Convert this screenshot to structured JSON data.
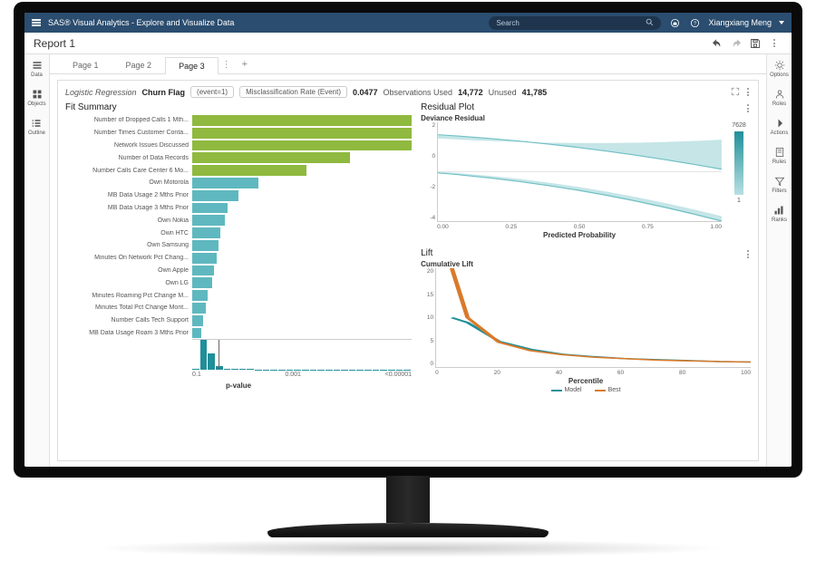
{
  "topbar": {
    "title": "SAS® Visual Analytics - Explore and Visualize Data",
    "search_placeholder": "Search",
    "user": "Xiangxiang Meng"
  },
  "report": {
    "title": "Report 1",
    "tabs": [
      "Page 1",
      "Page 2",
      "Page 3"
    ],
    "active_tab": 2
  },
  "left_rail": [
    {
      "id": "data",
      "label": "Data"
    },
    {
      "id": "objects",
      "label": "Objects"
    },
    {
      "id": "outline",
      "label": "Outline"
    }
  ],
  "right_rail": [
    {
      "id": "options",
      "label": "Options"
    },
    {
      "id": "roles",
      "label": "Roles"
    },
    {
      "id": "actions",
      "label": "Actions"
    },
    {
      "id": "rules",
      "label": "Rules"
    },
    {
      "id": "filters",
      "label": "Filters"
    },
    {
      "id": "ranks",
      "label": "Ranks"
    }
  ],
  "model_hdr": {
    "model_type": "Logistic Regression",
    "target": "Churn Flag",
    "event_label": "(event=1)",
    "metric_btn": "Misclassification Rate (Event)",
    "metric_val": "0.0477",
    "obs_used_label": "Observations Used",
    "obs_used": "14,772",
    "unused_label": "Unused",
    "unused": "41,785"
  },
  "chart_data": [
    {
      "type": "bar",
      "title": "Fit Summary",
      "xlabel": "p-value",
      "x_ticks": [
        "0.1",
        "0.001",
        "<0.00001"
      ],
      "orientation": "horizontal",
      "note": "bar length ∝ −log10(p); colors: green = p<0.05, teal = otherwise",
      "items": [
        {
          "label": "Number of Dropped Calls 1 Mth...",
          "len": 1.0,
          "sig": true
        },
        {
          "label": "Number Times Customer Conta...",
          "len": 1.0,
          "sig": true
        },
        {
          "label": "Network Issues Discussed",
          "len": 1.0,
          "sig": true
        },
        {
          "label": "Number of Data Records",
          "len": 0.72,
          "sig": true
        },
        {
          "label": "Number Calls Care Center 6 Mo...",
          "len": 0.52,
          "sig": true
        },
        {
          "label": "Own Motorola",
          "len": 0.3,
          "sig": false
        },
        {
          "label": "MB Data Usage 2 Mths Prior",
          "len": 0.21,
          "sig": false
        },
        {
          "label": "MB Data Usage 3 Mths Prior",
          "len": 0.16,
          "sig": false
        },
        {
          "label": "Own Nokia",
          "len": 0.15,
          "sig": false
        },
        {
          "label": "Own HTC",
          "len": 0.13,
          "sig": false
        },
        {
          "label": "Own Samsung",
          "len": 0.12,
          "sig": false
        },
        {
          "label": "Minutes On Network Pct Chang...",
          "len": 0.11,
          "sig": false
        },
        {
          "label": "Own Apple",
          "len": 0.1,
          "sig": false
        },
        {
          "label": "Own LG",
          "len": 0.09,
          "sig": false
        },
        {
          "label": "Minutes Roaming Pct Change M...",
          "len": 0.07,
          "sig": false
        },
        {
          "label": "Minutes Total Pct Change Mont...",
          "len": 0.06,
          "sig": false
        },
        {
          "label": "Number Calls Tech Support",
          "len": 0.05,
          "sig": false
        },
        {
          "label": "MB Data Usage Roam 3 Mths Prior",
          "len": 0.04,
          "sig": false
        }
      ],
      "histogram": {
        "heights": [
          0.05,
          1.0,
          0.55,
          0.12,
          0.05,
          0.04,
          0.03,
          0.05,
          0.02,
          0.02,
          0.01,
          0.02,
          0.01,
          0.01,
          0.02,
          0.01,
          0.01,
          0.02,
          0.01,
          0.01,
          0.02,
          0.01,
          0.01,
          0.01,
          0.02,
          0.01,
          0.01,
          0.02
        ]
      },
      "ref_line_frac": 0.12
    },
    {
      "type": "scatter",
      "title": "Residual Plot",
      "subtitle": "Deviance Residual",
      "xlabel": "Predicted Probability",
      "xlim": [
        0,
        1
      ],
      "x_ticks": [
        0.0,
        0.25,
        0.5,
        0.75,
        1.0
      ],
      "ylim": [
        -4,
        4
      ],
      "y_ticks": [
        -4,
        -2,
        0,
        2
      ],
      "color_scale": {
        "min": 1,
        "max": 7628
      },
      "bands": [
        {
          "y_start": 3.0,
          "y_end": 0.2,
          "x0": 0.0,
          "x1": 1.0
        },
        {
          "y_start": -0.1,
          "y_end": -4.0,
          "x0": 0.0,
          "x1": 1.0
        }
      ]
    },
    {
      "type": "line",
      "title": "Lift",
      "subtitle": "Cumulative Lift",
      "xlabel": "Percentile",
      "xlim": [
        0,
        100
      ],
      "x_ticks": [
        0,
        20,
        40,
        60,
        80,
        100
      ],
      "ylim": [
        0,
        20
      ],
      "y_ticks": [
        0,
        5,
        10,
        15,
        20
      ],
      "series": [
        {
          "name": "Model",
          "color": "#1f8f99",
          "x": [
            5,
            10,
            20,
            30,
            40,
            50,
            60,
            70,
            80,
            90,
            100
          ],
          "y": [
            10,
            9,
            5.2,
            3.6,
            2.6,
            2.1,
            1.7,
            1.5,
            1.3,
            1.1,
            1.0
          ]
        },
        {
          "name": "Best",
          "color": "#d97a2b",
          "x": [
            5,
            10,
            20,
            30,
            40,
            50,
            60,
            70,
            80,
            90,
            100
          ],
          "y": [
            20,
            10,
            5,
            3.3,
            2.5,
            2.0,
            1.7,
            1.4,
            1.25,
            1.1,
            1.0
          ]
        }
      ]
    }
  ]
}
